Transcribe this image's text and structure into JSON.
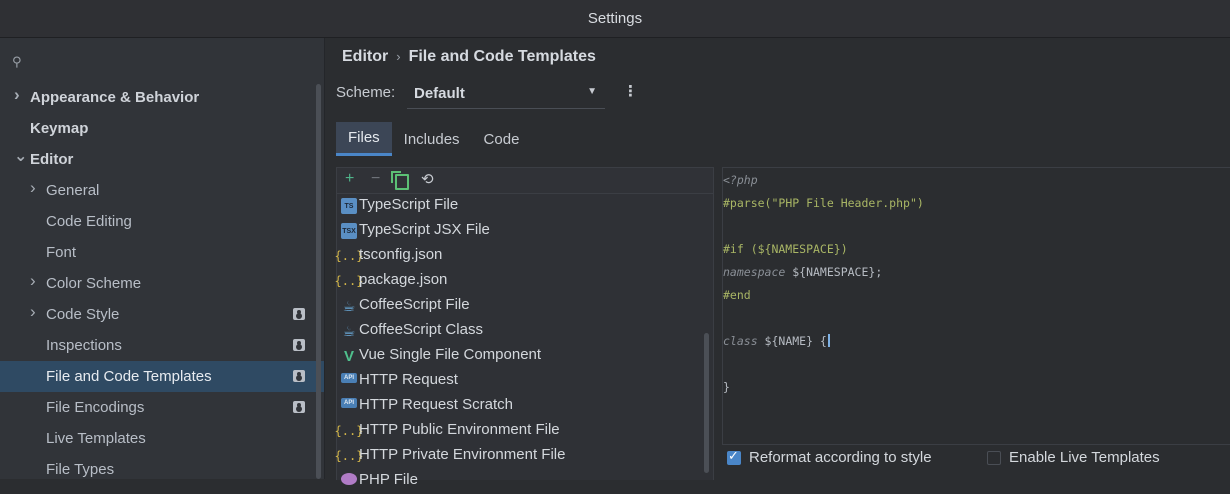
{
  "window": {
    "title": "Settings"
  },
  "sidebar": {
    "search_icon": "search-icon",
    "items": [
      {
        "label": "Appearance & Behavior",
        "expandable": true,
        "expanded": false,
        "bold": true,
        "level": 0
      },
      {
        "label": "Keymap",
        "expandable": false,
        "bold": true,
        "level": 0
      },
      {
        "label": "Editor",
        "expandable": true,
        "expanded": true,
        "bold": true,
        "level": 0
      },
      {
        "label": "General",
        "expandable": true,
        "expanded": false,
        "level": 1
      },
      {
        "label": "Code Editing",
        "level": 1
      },
      {
        "label": "Font",
        "level": 1
      },
      {
        "label": "Color Scheme",
        "expandable": true,
        "expanded": false,
        "level": 1
      },
      {
        "label": "Code Style",
        "expandable": true,
        "expanded": false,
        "level": 1,
        "badge": "project-icon"
      },
      {
        "label": "Inspections",
        "level": 1,
        "badge": "project-icon"
      },
      {
        "label": "File and Code Templates",
        "level": 1,
        "badge": "project-icon",
        "selected": true
      },
      {
        "label": "File Encodings",
        "level": 1,
        "badge": "project-icon"
      },
      {
        "label": "Live Templates",
        "level": 1
      },
      {
        "label": "File Types",
        "level": 1
      }
    ]
  },
  "breadcrumb": {
    "parent": "Editor",
    "current": "File and Code Templates",
    "separator": "›"
  },
  "scheme": {
    "label": "Scheme:",
    "value": "Default",
    "menu_icon": "kebab-menu-icon"
  },
  "tabs": [
    {
      "label": "Files",
      "active": true
    },
    {
      "label": "Includes",
      "active": false
    },
    {
      "label": "Code",
      "active": false
    }
  ],
  "toolbar": {
    "add": "+",
    "remove": "−",
    "reset": "⟲"
  },
  "files": [
    {
      "label": "TypeScript File",
      "icon": "typescript-file-icon",
      "glyph": "TS",
      "kind": "ts"
    },
    {
      "label": "TypeScript JSX File",
      "icon": "typescript-jsx-file-icon",
      "glyph": "TSX",
      "kind": "ts"
    },
    {
      "label": "tsconfig.json",
      "icon": "json-file-icon",
      "glyph": "{..}",
      "kind": "json"
    },
    {
      "label": "package.json",
      "icon": "json-file-icon",
      "glyph": "{..}",
      "kind": "json"
    },
    {
      "label": "CoffeeScript File",
      "icon": "coffeescript-file-icon",
      "glyph": "☕",
      "kind": "coffee"
    },
    {
      "label": "CoffeeScript Class",
      "icon": "coffeescript-class-icon",
      "glyph": "☕",
      "kind": "coffee"
    },
    {
      "label": "Vue Single File Component",
      "icon": "vue-file-icon",
      "glyph": "V",
      "kind": "vue"
    },
    {
      "label": "HTTP Request",
      "icon": "http-request-icon",
      "glyph": "API",
      "kind": "api"
    },
    {
      "label": "HTTP Request Scratch",
      "icon": "http-request-scratch-icon",
      "glyph": "API",
      "kind": "api"
    },
    {
      "label": "HTTP Public Environment File",
      "icon": "json-file-icon",
      "glyph": "{..}",
      "kind": "json"
    },
    {
      "label": "HTTP Private Environment File",
      "icon": "json-file-icon",
      "glyph": "{..}",
      "kind": "json"
    },
    {
      "label": "PHP File",
      "icon": "php-file-icon",
      "glyph": "",
      "kind": "php"
    }
  ],
  "editor": {
    "lines": [
      [
        {
          "t": "<?php",
          "c": "c-tag"
        }
      ],
      [
        {
          "t": "#parse(",
          "c": "c-dir"
        },
        {
          "t": "\"PHP File Header.php\"",
          "c": "c-str"
        },
        {
          "t": ")",
          "c": "c-dir"
        }
      ],
      [],
      [
        {
          "t": "#if (${NAMESPACE})",
          "c": "c-dir"
        }
      ],
      [
        {
          "t": "namespace",
          "c": "c-kw"
        },
        {
          "t": " ${NAMESPACE};",
          "c": "c-var"
        }
      ],
      [
        {
          "t": "#end",
          "c": "c-dir"
        }
      ],
      [],
      [
        {
          "t": "class",
          "c": "c-kw"
        },
        {
          "t": " ${NAME} {",
          "c": "c-var"
        }
      ],
      [],
      [
        {
          "t": "}",
          "c": "c-var"
        }
      ]
    ],
    "caret_line": 7
  },
  "options": {
    "reformat": {
      "label": "Reformat according to style",
      "checked": true
    },
    "live_templates": {
      "label": "Enable Live Templates",
      "checked": false
    }
  }
}
